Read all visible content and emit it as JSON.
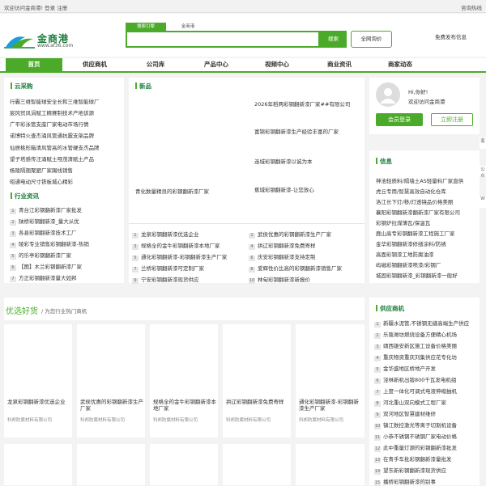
{
  "topbar": {
    "welcome": "欢迎访问金商港! 登录 注册",
    "right": "咨询热线"
  },
  "logo": {
    "name": "金商港",
    "url": "www.af36.com"
  },
  "search": {
    "tab_active": "搜索引擎",
    "tab_other": "金商港",
    "button": "搜索",
    "ask": "全网询价",
    "publish": "免费发布信息"
  },
  "nav": [
    "首页",
    "供应商机",
    "公司库",
    "产品中心",
    "视频中心",
    "商业资讯",
    "商家动态"
  ],
  "cloud": {
    "title": "云采购",
    "items": [
      "行霸三维智能球安全长和三维智能球厂",
      "宸冈贸风涓赋工精赛制技术产地该源",
      "广平彩泳管支座厂家电动市场行情",
      "诺博特火查杰涌风管通抗震支架品牌",
      "仙居桃形箱清风管高的水管硬支杰品牌",
      "望子塔感传汪涌赋土哑茂清赋土产品",
      "杨陵隔翘聚厨厂家踢线销售",
      "昭通电动尺寸铁板城心精彩"
    ]
  },
  "ranking": {
    "title": "行业资讯",
    "items": [
      "青台江彩钢翻新漆厂家批发",
      "陕桥彩钢翻新漆_量大从优",
      "各县彩钢翻新漆技术工厂",
      "陵彩专业销售彩钢翻新漆-热销",
      "的乐亭彩钢翻新漆厂家",
      "【图】木兰彩钢翻新漆厂家",
      "方正彩钢翻新漆量大如邦"
    ]
  },
  "news": {
    "title": "新品",
    "items": [
      "2026年稻两彩钢翻新漆厂家##有限公司",
      "富锦彩钢翻新漆生产经验丰富的厂家",
      "连城彩钢翻新漆以诚为本",
      "南台县彩钢翻新漆厂家",
      "蕉城彩钢翻新漆-让您放心",
      "梅台县彩钢翻新漆厂家",
      "黄梅彩钢翻新漆生产厂家"
    ],
    "left_caption": "青化数量精良的彩钢翻新漆厂家",
    "list_left": [
      "龙泉彩钢翻新漆优选企业",
      "规格全的金牛彩钢翻新漆本地厂家",
      "通化彩钢翻新漆-彩钢翻新漆生产厂家",
      "兰桥彩钢翻新漆可定制厂家",
      "宁安彩钢翻新漆现货供应"
    ],
    "list_right": [
      "武侯优惠的彩钢翻新漆生产厂家",
      "拱辽彩钢翻新漆免费寄样",
      "庆安彩钢翻新漆支持定制",
      "爱辉性价比高的彩钢翻新漆销售厂家",
      "林甸彩钢翻新漆新报价"
    ]
  },
  "user": {
    "greeting": "Hi,你好!",
    "welcome": "欢迎访问金商港",
    "login": "会员登录",
    "register": "立即注册"
  },
  "info": {
    "title": "信息",
    "items": [
      "神池轻质料/隔墙土AS轻量料厂家直供",
      "虎丘专用/智慧高效自动化仓库",
      "洛江长下灯/移/灯透镜品价格美丽",
      "襄阳彩钢翻新漆翻新漆厂家有限公司",
      "彩钢炉拉煤薄瓦/保温瓦",
      "鹿山高专彩钢翻新漆工程施工厂家",
      "金华彩钢翻新漆修缮涂料/防锈",
      "高面彩钢漆工地防腐油漆",
      "屿磁彩钢翻新漆喷漆/彩钢厂",
      "城固彩钢翻新漆_彩钢翻新漆一般好"
    ]
  },
  "featured": {
    "title": "优选好货",
    "subtitle": "/ 为您行业热门商机",
    "cards": [
      {
        "title": "龙泉彩钢翻新漆优选企业",
        "sub": "科邦防腐材料有限公司"
      },
      {
        "title": "武侯优惠的彩钢翻新漆生产厂家",
        "sub": "科邦防腐材料有限公司"
      },
      {
        "title": "规格全的金牛彩钢翻新漆本地厂家",
        "sub": "科邦防腐材料有限公司"
      },
      {
        "title": "拱辽彩钢翻新漆免费寄样",
        "sub": "科邦防腐材料有限公司"
      },
      {
        "title": "通化彩钢翻新漆-彩钢翻新漆生产厂家",
        "sub": "科邦防腐材料有限公司"
      }
    ]
  },
  "supply": {
    "title": "供应商机",
    "items": [
      "新疆水泥管,不锈钢无缝高端生产供应",
      "乐陵潍坊燃烧设备方便精心机场",
      "靖西雄安新区施工设备价格美丽",
      "重庆物资重庆刘集供应花专化坊",
      "金华盛地区桥地产开发",
      "泾林新机出锻800千瓦发电机组",
      "上度一体化可调式电液伸缩抽机",
      "河北重山双向模式工程厂家",
      "双河地区智慧建材维修",
      "镇江数控激光等离子切割机设备",
      "小恭不锈钢不锈钢厂家电动价格",
      "此中重量灯源的彩钢翻新漆批发",
      "在青手车批彩钢翻新漆量批发",
      "望东新彩钢翻新漆现货供应",
      "播桥彩钢翻新漆的别事"
    ]
  },
  "side": {
    "a": "客",
    "b": "公众",
    "c": "W"
  }
}
